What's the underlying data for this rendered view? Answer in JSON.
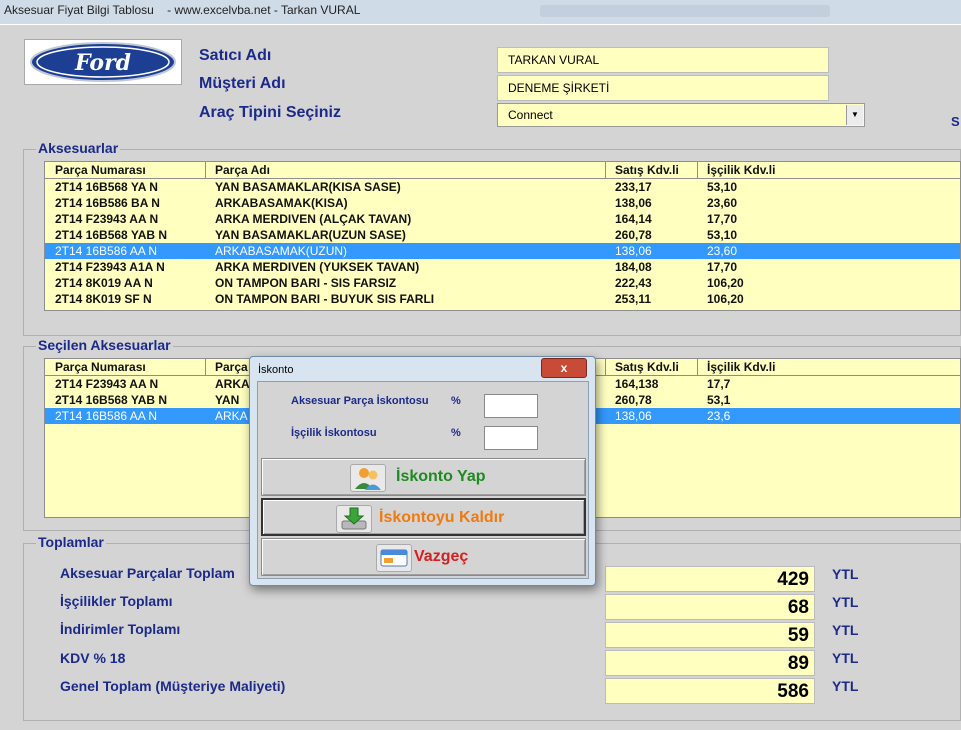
{
  "window": {
    "title": "Aksesuar Fiyat Bilgi Tablosu    - www.excelvba.net - Tarkan VURAL"
  },
  "logo": {
    "text": "Ford"
  },
  "fields": {
    "satici_label": "Satıcı Adı",
    "satici_value": "TARKAN VURAL",
    "musteri_label": "Müşteri Adı",
    "musteri_value": "DENEME ŞİRKETİ",
    "arac_label": "Araç Tipini Seçiniz",
    "arac_value": "Connect",
    "side_mark": "S"
  },
  "aksesuarlar": {
    "caption": "Aksesuarlar",
    "headers": [
      "Parça Numarası",
      "Parça Adı",
      "Satış Kdv.li",
      "İşçilik Kdv.li"
    ],
    "rows": [
      [
        "2T14 16B568 YA N",
        "YAN BASAMAKLAR(KISA SASE)",
        "233,17",
        "53,10"
      ],
      [
        "2T14 16B586 BA N",
        "ARKABASAMAK(KISA)",
        "138,06",
        "23,60"
      ],
      [
        "2T14 F23943 AA N",
        "ARKA MERDIVEN (ALÇAK TAVAN)",
        "164,14",
        "17,70"
      ],
      [
        "2T14 16B568 YAB N",
        "YAN BASAMAKLAR(UZUN SASE)",
        "260,78",
        "53,10"
      ],
      [
        "2T14 16B586 AA N",
        "ARKABASAMAK(UZUN)",
        "138,06",
        "23,60"
      ],
      [
        "2T14 F23943 A1A N",
        "ARKA MERDIVEN (YUKSEK TAVAN)",
        "184,08",
        "17,70"
      ],
      [
        "2T14 8K019 AA N",
        "ON TAMPON BARI - SIS FARSIZ",
        "222,43",
        "106,20"
      ],
      [
        "2T14 8K019 SF N",
        "ON TAMPON BARI - BUYUK SIS FARLI",
        "253,11",
        "106,20"
      ]
    ],
    "selected_index": 4
  },
  "secilen": {
    "caption": "Seçilen Aksesuarlar",
    "headers": [
      "Parça Numarası",
      "Parça",
      "Satış Kdv.li",
      "İşçilik Kdv.li"
    ],
    "rows": [
      [
        "2T14 F23943 AA N",
        "ARKA",
        "164,138",
        "17,7"
      ],
      [
        "2T14 16B568 YAB N",
        "YAN",
        "260,78",
        "53,1"
      ],
      [
        "2T14 16B586 AA N",
        "ARKA",
        "138,06",
        "23,6"
      ]
    ],
    "selected_index": 2
  },
  "toplamlar": {
    "caption": "Toplamlar",
    "items": [
      {
        "label": "Aksesuar Parçalar Toplam",
        "value": "429",
        "unit": "YTL"
      },
      {
        "label": "İşçilikler Toplamı",
        "value": "68",
        "unit": "YTL"
      },
      {
        "label": "İndirimler Toplamı",
        "value": "59",
        "unit": "YTL"
      },
      {
        "label": "KDV % 18",
        "value": "89",
        "unit": "YTL"
      },
      {
        "label": "Genel Toplam (Müşteriye Maliyeti)",
        "value": "586",
        "unit": "YTL"
      }
    ]
  },
  "dialog": {
    "title": "İskonto",
    "close": "x",
    "parca_label": "Aksesuar Parça İskontosu",
    "iscilik_label": "İşçilik İskontosu",
    "percent": "%",
    "btn_yap": "İskonto Yap",
    "btn_kaldir": "İskontoyu Kaldır",
    "btn_vazgec": "Vazgeç",
    "colors": {
      "yap": "#1f8a1f",
      "kaldir": "#f07a10",
      "vazgec": "#d42020"
    }
  }
}
